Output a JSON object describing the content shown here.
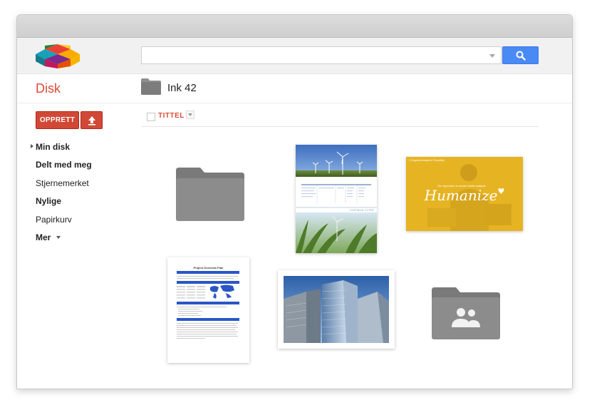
{
  "app": {
    "section_title": "Disk"
  },
  "search": {
    "value": "",
    "placeholder": "",
    "button_icon": "search-icon"
  },
  "breadcrumb": {
    "folder_title": "Ink 42"
  },
  "toolbar": {
    "create_label": "OPPRETT",
    "upload_icon": "upload-icon"
  },
  "sidebar": {
    "items": [
      {
        "label": "Min disk"
      },
      {
        "label": "Delt med meg"
      },
      {
        "label": "Stjernemerket"
      },
      {
        "label": "Nylige"
      },
      {
        "label": "Papirkurv"
      },
      {
        "label": "Mer"
      }
    ]
  },
  "list_header": {
    "title_column": "TITTEL"
  },
  "thumbnails": {
    "wind_doc_caption": "CONTINUAL 2.0 PRE",
    "humanize_slide": {
      "heading": "1 Ongoing Analysis & Reporting",
      "subtitle": "Our approach to social media analysis",
      "title": "Humanize"
    },
    "project_plan_title": "Project Overview Plan"
  },
  "colors": {
    "accent_red": "#dd4b39",
    "button_red": "#d14836",
    "search_blue": "#4a8af4",
    "folder_gray": "#8a8a8a",
    "slide_yellow": "#e8b923"
  }
}
